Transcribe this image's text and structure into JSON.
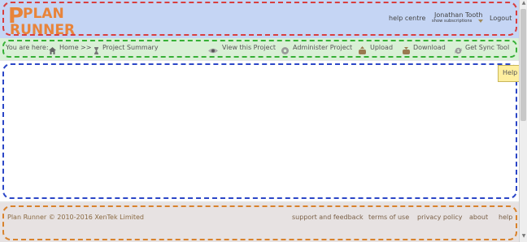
{
  "header": {
    "logo_line1": "PLAN",
    "logo_line2": "RUNNER",
    "help_centre": "help centre",
    "user_name": "Jonathan Tooth",
    "show_subscriptions": "show subscriptions",
    "logout": "Logout"
  },
  "nav": {
    "you_are_here": "You are here:",
    "home": "Home",
    "separator": ">>",
    "project_summary": "Project Summary",
    "view_project": "View this Project",
    "administer_project": "Administer Project",
    "upload": "Upload",
    "download": "Download",
    "get_sync_tool": "Get Sync Tool"
  },
  "main": {
    "help_tab": "Help"
  },
  "footer": {
    "copyright": "Plan Runner © 2010-2016 XenTek Limited",
    "support": "support and feedback",
    "terms": "terms of use",
    "privacy": "privacy policy",
    "about": "about",
    "help": "help"
  },
  "colors": {
    "header_bg": "#c5d5f4",
    "header_border": "#d83e3e",
    "nav_bg": "#d9f0d6",
    "nav_border": "#36b036",
    "main_border": "#2b46c7",
    "footer_bg": "#e7e2e2",
    "footer_border": "#d8822c",
    "logo_orange": "#e8843a"
  },
  "icons": {
    "home": "home-icon",
    "hourglass": "hourglass-icon",
    "view": "eye-icon",
    "administer": "gear-icon",
    "upload": "upload-icon",
    "download": "download-icon",
    "sync": "sync-icon"
  }
}
